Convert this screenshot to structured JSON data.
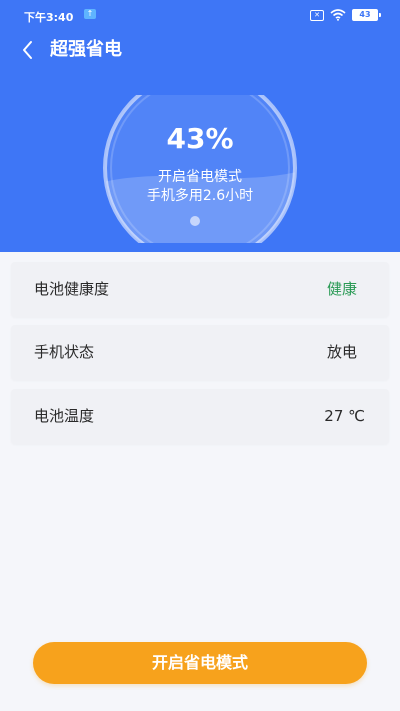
{
  "status_bar": {
    "time": "下午3:40",
    "upload_icon": "upload-icon",
    "battery_level": "43"
  },
  "header": {
    "back_icon": "chevron-left-icon",
    "title": "超强省电"
  },
  "gauge": {
    "percent": "43%",
    "mode_text": "开启省电模式",
    "extra_text": "手机多用2.6小时"
  },
  "cards": [
    {
      "label": "电池健康度",
      "value": "健康"
    },
    {
      "label": "手机状态",
      "value": "放电"
    },
    {
      "label": "电池温度",
      "value": "27 ℃"
    }
  ],
  "action": {
    "label": "开启省电模式"
  },
  "colors": {
    "header_bg": "#3e76f6",
    "healthy": "#2a9a55",
    "button_bg": "#f7a21c"
  }
}
